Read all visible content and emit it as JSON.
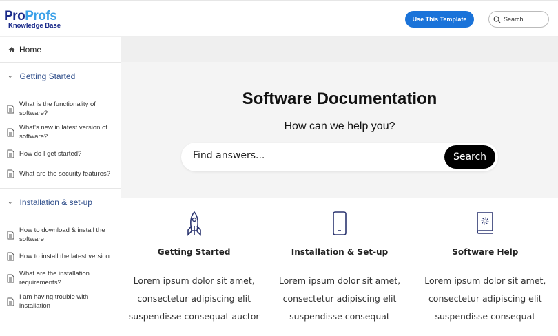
{
  "header": {
    "logo_pro": "Pro",
    "logo_profs": "Profs",
    "logo_sub": "Knowledge Base",
    "template_button": "Use This Template",
    "search_placeholder": "Search"
  },
  "sidebar": {
    "home": "Home",
    "sections": [
      {
        "title": "Getting Started",
        "items": [
          "What is the functionality of software?",
          "What's new in latest version of software?",
          "How do I get started?",
          "What are the security features?"
        ]
      },
      {
        "title": "Installation & set-up",
        "items": [
          "How to download & install the software",
          "How to install the latest version",
          "What are the installation requirements?",
          "I am having trouble with installation"
        ]
      }
    ]
  },
  "hero": {
    "title": "Software Documentation",
    "subtitle": "How can we help you?",
    "search_placeholder": "Find answers...",
    "search_button": "Search"
  },
  "cards": [
    {
      "title": "Getting Started",
      "icon": "rocket-icon",
      "lines": [
        "Lorem ipsum dolor sit amet,",
        "consectetur adipiscing elit",
        "suspendisse consequat auctor"
      ]
    },
    {
      "title": "Installation & Set-up",
      "icon": "mobile-icon",
      "lines": [
        "Lorem ipsum dolor sit amet,",
        "consectetur adipiscing elit",
        "suspendisse consequat"
      ]
    },
    {
      "title": "Software Help",
      "icon": "book-gear-icon",
      "lines": [
        "Lorem ipsum dolor sit amet,",
        "consectetur adipiscing elit",
        "suspendisse consequat"
      ]
    }
  ],
  "colors": {
    "accent": "#1a73d9",
    "section": "#2e4d8a",
    "icon": "#2b3570"
  }
}
